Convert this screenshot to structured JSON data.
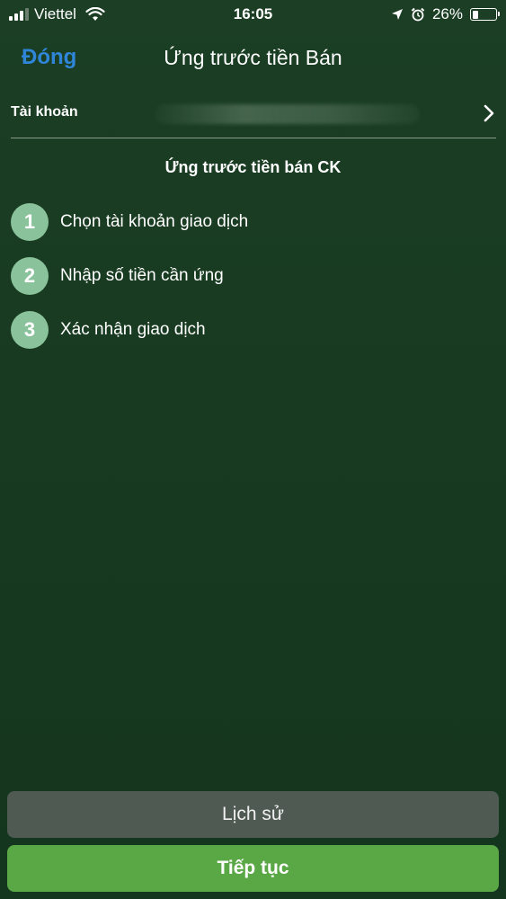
{
  "status_bar": {
    "carrier": "Viettel",
    "time": "16:05",
    "battery": "26%",
    "battery_level": 0.26,
    "signal_bars_active": 3,
    "signal_bars_total": 4
  },
  "nav": {
    "close_label": "Đóng",
    "title": "Ứng trước tiền Bán"
  },
  "account": {
    "label": "Tài khoản"
  },
  "section": {
    "title": "Ứng trước tiền bán CK"
  },
  "steps": [
    {
      "number": "1",
      "label": "Chọn tài khoản giao dịch"
    },
    {
      "number": "2",
      "label": "Nhập số tiền cần ứng"
    },
    {
      "number": "3",
      "label": "Xác nhận giao dịch"
    }
  ],
  "buttons": {
    "history": "Lịch sử",
    "continue": "Tiếp tục"
  },
  "colors": {
    "background": "#173a21",
    "link_blue": "#2f86d8",
    "step_badge": "#8ac39b",
    "history_button": "#4f5a53",
    "continue_button": "#5aa746"
  },
  "icons": {
    "wifi": "wifi-icon",
    "location": "location-arrow-icon",
    "alarm": "alarm-clock-icon",
    "battery": "battery-icon",
    "chevron": "chevron-right-icon"
  }
}
